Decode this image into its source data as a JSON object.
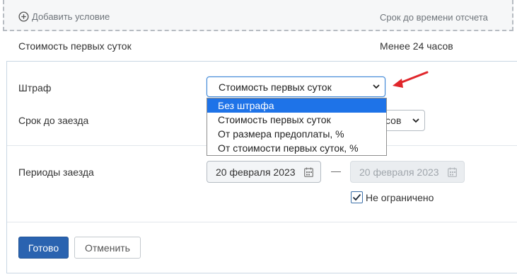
{
  "header": {
    "add_condition_label": "Добавить условие",
    "term_column_label": "Срок до времени отсчета"
  },
  "summary": {
    "penalty_value": "Стоимость первых суток",
    "term_value": "Менее 24 часов"
  },
  "form": {
    "penalty_label": "Штраф",
    "penalty_selected": "Стоимость первых суток",
    "penalty_options": [
      "Без штрафа",
      "Стоимость первых суток",
      "От размера предоплаты, %",
      "От стоимости первых суток, %"
    ],
    "highlighted_option_index": 0,
    "deadline_label": "Срок до заезда",
    "deadline_unit_visible": "сов",
    "periods_label": "Периоды заезда",
    "date_from": "20 февраля 2023",
    "date_separator": "—",
    "date_to": "20 февраля 2023",
    "unlimited_label": "Не ограничено",
    "unlimited_checked": true
  },
  "buttons": {
    "done_label": "Готово",
    "cancel_label": "Отменить"
  },
  "icons": [
    "plus-circle-icon",
    "chevron-down-icon",
    "calendar-icon",
    "checkmark-icon",
    "red-arrow-annotation"
  ],
  "colors": {
    "accent": "#2a63b0",
    "focus_border": "#3d86d6",
    "dropdown_highlight": "#1e73e8",
    "annotation_red": "#e0262b"
  }
}
